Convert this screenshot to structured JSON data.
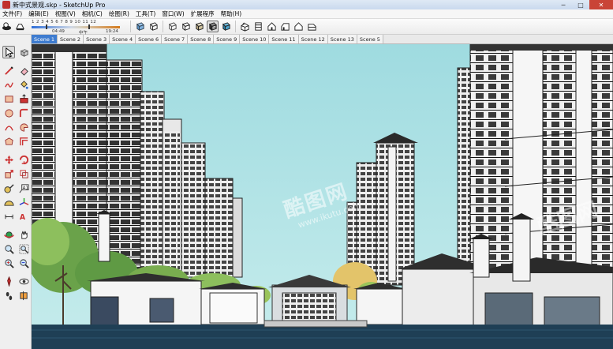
{
  "window": {
    "title": "新中式景观.skp - SketchUp Pro",
    "minimize": "─",
    "maximize": "□",
    "close": "✕"
  },
  "menu": [
    {
      "label": "文件(F)"
    },
    {
      "label": "编辑(E)"
    },
    {
      "label": "视图(V)"
    },
    {
      "label": "相机(C)"
    },
    {
      "label": "绘图(R)"
    },
    {
      "label": "工具(T)"
    },
    {
      "label": "窗口(W)"
    },
    {
      "label": "扩展程序"
    },
    {
      "label": "帮助(H)"
    }
  ],
  "shadow_settings": {
    "months": "1 2 3 4 5 6 7 8 9 10 11 12",
    "time_start": "04:49",
    "time_mid": "中午",
    "time_end": "19:24"
  },
  "scenes": [
    {
      "label": "Scene 1",
      "active": true
    },
    {
      "label": "Scene 2"
    },
    {
      "label": "Scene 3"
    },
    {
      "label": "Scene 4"
    },
    {
      "label": "Scene 6"
    },
    {
      "label": "Scene 7"
    },
    {
      "label": "Scene 8"
    },
    {
      "label": "Scene 9"
    },
    {
      "label": "Scene 10"
    },
    {
      "label": "Scene 11"
    },
    {
      "label": "Scene 12"
    },
    {
      "label": "Scene 13"
    },
    {
      "label": "Scene 5"
    }
  ],
  "watermark": {
    "logo_text": "酷图网",
    "url": "www.ikutu.com"
  },
  "colors": {
    "sky": "#a8dfe2",
    "active_tab": "#3e7cd0",
    "water": "#1f3f55"
  }
}
